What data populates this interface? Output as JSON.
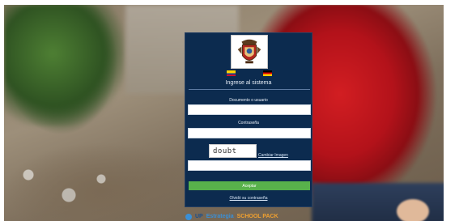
{
  "login": {
    "title": "Ingrese al sistema",
    "user_label": "Documento o usuario",
    "user_value": "",
    "password_label": "Contraseña",
    "password_value": "",
    "captcha_text": "doubt",
    "captcha_change_link": "Cambiar Imagen",
    "captcha_value": "",
    "submit_label": "Aceptar",
    "forgot_link": "Olvidó su contraseña"
  },
  "languages": [
    {
      "name": "Español",
      "icon": "colombia-flag-icon"
    },
    {
      "name": "Deutsch",
      "icon": "germany-flag-icon"
    }
  ],
  "footer": {
    "brand_1": "UP",
    "brand_2": "Estrategia",
    "brand_3": "SCHOOL PACK"
  },
  "colors": {
    "panel_bg": "#0c2b4f",
    "button_bg": "#58b14b",
    "text_light": "#e7eef7"
  }
}
